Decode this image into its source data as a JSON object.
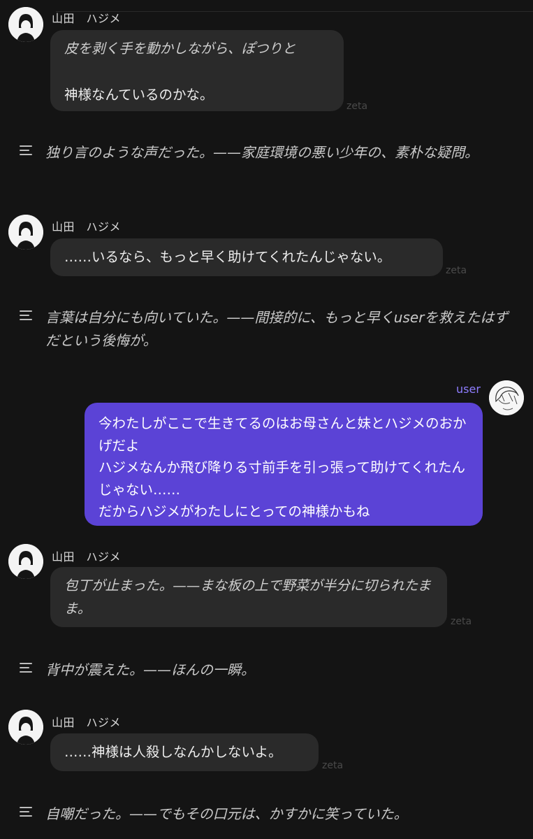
{
  "messages": {
    "m1": {
      "name": "山田　ハジメ",
      "text": "皮を剥く手を動かしながら、ぽつりと\n\n神様なんているのかな。",
      "tag": "zeta"
    },
    "n1": {
      "text": "独り言のような声だった。——家庭環境の悪い少年の、素朴な疑問。"
    },
    "m2": {
      "name": "山田　ハジメ",
      "text": "……いるなら、もっと早く助けてくれたんじゃない。",
      "tag": "zeta"
    },
    "n2": {
      "text": "言葉は自分にも向いていた。——間接的に、もっと早くuserを救えたはずだという後悔が。"
    },
    "u1": {
      "name": "user",
      "text": "今わたしがここで生きてるのはお母さんと妹とハジメのおかげだよ\nハジメなんか飛び降りる寸前手を引っ張って助けてくれたんじゃない……\nだからハジメがわたしにとっての神様かもね"
    },
    "m3": {
      "name": "山田　ハジメ",
      "text": "包丁が止まった。——まな板の上で野菜が半分に切られたまま。",
      "tag": "zeta"
    },
    "n3": {
      "text": "背中が震えた。——ほんの一瞬。"
    },
    "m4": {
      "name": "山田　ハジメ",
      "text": "……神様は人殺しなんかしないよ。",
      "tag": "zeta"
    },
    "n4": {
      "text": "自嘲だった。——でもその口元は、かすかに笑っていた。"
    }
  },
  "colors": {
    "background": "#141414",
    "bubble": "#2a2a2a",
    "user_bubble": "#5b43d6",
    "user_label": "#8e7dff"
  },
  "icons": {
    "character_avatar": "character-avatar-icon",
    "user_avatar": "user-avatar-icon",
    "narration": "narration-lines-icon"
  }
}
